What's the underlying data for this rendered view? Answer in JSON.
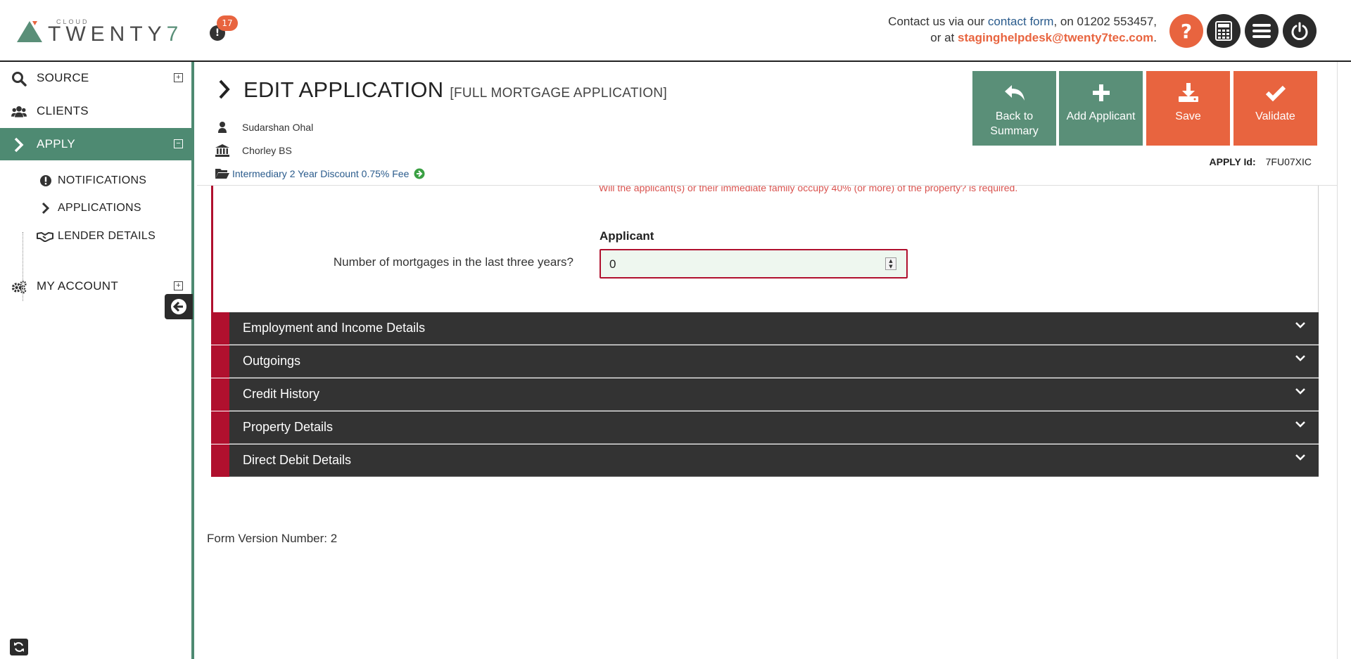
{
  "header": {
    "logo_small": "CLOUD",
    "logo_word": "TWENTY",
    "logo_seven": "7",
    "notification_count": "17",
    "contact": {
      "prefix": "Contact us via our",
      "link": "contact form",
      "phone_text": ", on 01202 553457,",
      "or_text": "or at",
      "email": "staginghelpdesk@twenty7tec.com",
      "suffix": "."
    },
    "icons": [
      "help-icon",
      "calculator-icon",
      "menu-icon",
      "power-icon"
    ],
    "help_glyph": "?"
  },
  "sidebar": {
    "items": [
      {
        "label": "SOURCE",
        "icon": "search-icon",
        "toggle": "+"
      },
      {
        "label": "CLIENTS",
        "icon": "users-icon"
      },
      {
        "label": "APPLY",
        "icon": "chevron-right-icon",
        "toggle": "−"
      },
      {
        "label": "MY ACCOUNT",
        "icon": "gears-icon",
        "toggle": "+"
      }
    ],
    "sub_items": [
      {
        "label": "NOTIFICATIONS",
        "icon": "exclamation-icon"
      },
      {
        "label": "APPLICATIONS",
        "icon": "chevron-right-icon"
      },
      {
        "label": "LENDER DETAILS",
        "icon": "handshake-icon"
      }
    ]
  },
  "page": {
    "title": "EDIT APPLICATION",
    "subtitle": "[FULL MORTGAGE APPLICATION]",
    "client_name": "Sudarshan Ohal",
    "lender": "Chorley BS",
    "product": "Intermediary 2 Year Discount 0.75% Fee",
    "apply_id_label": "APPLY Id:",
    "apply_id": "7FU07XIC"
  },
  "actions": [
    {
      "label": "Back to Summary",
      "icon": "reply-icon"
    },
    {
      "label": "Add Applicant",
      "icon": "plus-icon"
    },
    {
      "label": "Save",
      "icon": "download-icon"
    },
    {
      "label": "Validate",
      "icon": "check-icon"
    }
  ],
  "form": {
    "error_message": "Will the applicant(s) or their immediate family occupy 40% (or more) of the property? is required.",
    "column_header": "Applicant",
    "field_label": "Number of mortgages in the last three years?",
    "field_value": "0"
  },
  "sections": [
    "Employment and Income Details",
    "Outgoings",
    "Credit History",
    "Property Details",
    "Direct Debit Details"
  ],
  "footer": {
    "form_version": "Form Version Number: 2"
  },
  "colors": {
    "brand_green": "#4e8a72",
    "accent_orange": "#e8643f",
    "error_red": "#b0102e",
    "section_dark": "#333333"
  }
}
